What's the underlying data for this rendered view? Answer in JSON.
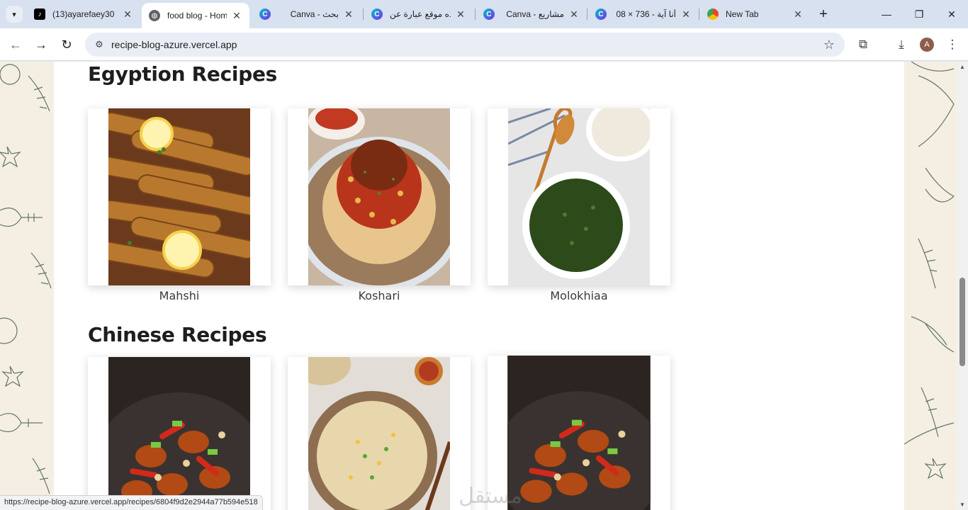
{
  "browser": {
    "tabs": [
      {
        "title": "(13)ayarefaey30",
        "icon": "tiktok-icon",
        "active": false
      },
      {
        "title": "food blog - Hom",
        "icon": "globe-icon",
        "active": true
      },
      {
        "title": "Canva - بحث",
        "icon": "canva-icon",
        "active": false
      },
      {
        "title": "ده موقع عبارة عن",
        "icon": "canva-icon",
        "active": false
      },
      {
        "title": "Canva - مشاريع",
        "icon": "canva-icon",
        "active": false
      },
      {
        "title": "أنا آية - 736 × 08",
        "icon": "canva-icon",
        "active": false
      },
      {
        "title": "New Tab",
        "icon": "chrome-icon",
        "active": false
      }
    ],
    "address": "recipe-blog-azure.vercel.app",
    "profile_initial": "A",
    "status_url": "https://recipe-blog-azure.vercel.app/recipes/6804f9d2e2944a77b594e518"
  },
  "page": {
    "sections": [
      {
        "title": "Egyption Recipes",
        "recipes": [
          {
            "name": "Mahshi",
            "image": "mahshi-image"
          },
          {
            "name": "Koshari",
            "image": "koshari-image"
          },
          {
            "name": "Molokhiaa",
            "image": "molokhiaa-image"
          }
        ]
      },
      {
        "title": "Chinese Recipes",
        "recipes": [
          {
            "name": "",
            "image": "kung-pao-chicken-image"
          },
          {
            "name": "",
            "image": "fried-rice-image"
          },
          {
            "name": "",
            "image": "kung-pao-chicken-image"
          }
        ]
      }
    ]
  },
  "colors": {
    "background": "#f5efe3",
    "page": "#ffffff",
    "heading": "#1e1e1e"
  },
  "watermark_text": "مستقل"
}
